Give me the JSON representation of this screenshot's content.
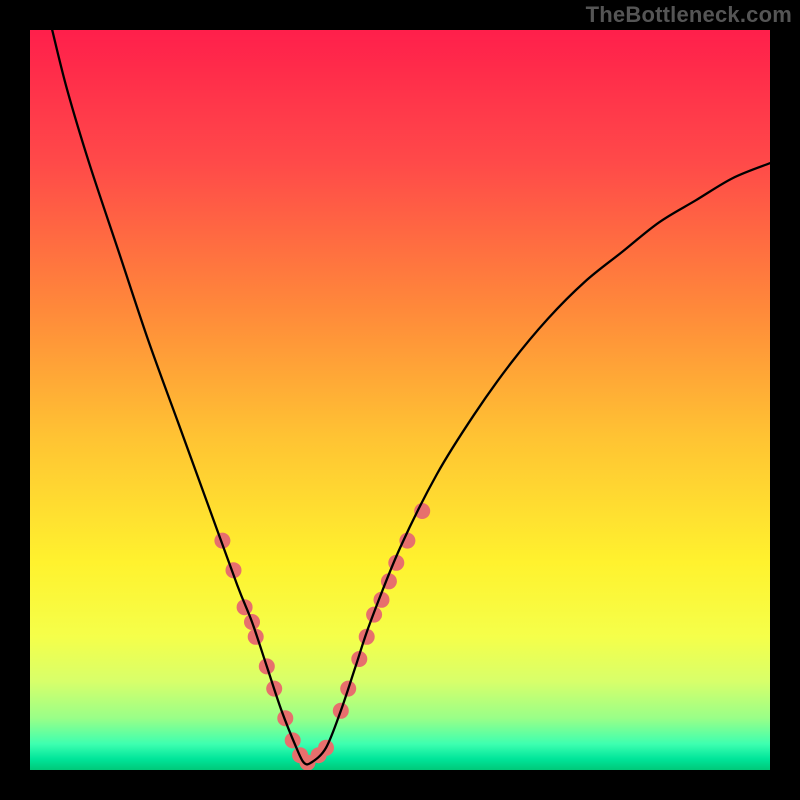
{
  "watermark": "TheBottleneck.com",
  "chart_data": {
    "type": "line",
    "title": "",
    "xlabel": "",
    "ylabel": "",
    "xlim": [
      0,
      100
    ],
    "ylim": [
      0,
      100
    ],
    "curve": {
      "name": "bottleneck-curve",
      "x": [
        3,
        5,
        8,
        12,
        16,
        20,
        24,
        28,
        30,
        32,
        34,
        36,
        37,
        38,
        40,
        42,
        44,
        46,
        50,
        55,
        60,
        65,
        70,
        75,
        80,
        85,
        90,
        95,
        100
      ],
      "y": [
        100,
        92,
        82,
        70,
        58,
        47,
        36,
        25,
        20,
        14,
        8,
        3,
        1,
        1,
        3,
        8,
        14,
        20,
        30,
        40,
        48,
        55,
        61,
        66,
        70,
        74,
        77,
        80,
        82
      ]
    },
    "highlight_points": {
      "name": "highlighted-range",
      "x": [
        26,
        27.5,
        29,
        30,
        30.5,
        32,
        33,
        34.5,
        35.5,
        36.5,
        37.5,
        39,
        40,
        42,
        43,
        44.5,
        45.5,
        46.5,
        47.5,
        48.5,
        49.5,
        51,
        53
      ],
      "y": [
        31,
        27,
        22,
        20,
        18,
        14,
        11,
        7,
        4,
        2,
        1,
        2,
        3,
        8,
        11,
        15,
        18,
        21,
        23,
        25.5,
        28,
        31,
        35
      ],
      "color": "#e76f6d",
      "radius": 8
    },
    "gradient_stops": [
      {
        "offset": 0.0,
        "color": "#ff1f4b"
      },
      {
        "offset": 0.18,
        "color": "#ff4a49"
      },
      {
        "offset": 0.38,
        "color": "#ff8a3a"
      },
      {
        "offset": 0.55,
        "color": "#ffc333"
      },
      {
        "offset": 0.72,
        "color": "#fff22e"
      },
      {
        "offset": 0.82,
        "color": "#f5ff4a"
      },
      {
        "offset": 0.88,
        "color": "#d8ff6a"
      },
      {
        "offset": 0.93,
        "color": "#99ff88"
      },
      {
        "offset": 0.965,
        "color": "#3dffb0"
      },
      {
        "offset": 0.985,
        "color": "#00e59a"
      },
      {
        "offset": 1.0,
        "color": "#00c878"
      }
    ]
  }
}
